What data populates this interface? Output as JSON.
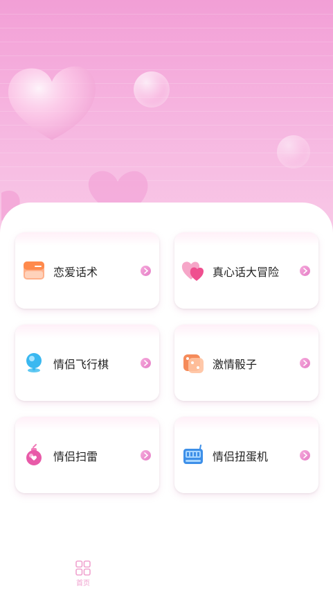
{
  "colors": {
    "accent": "#f29fd6",
    "card_bg": "#ffffff",
    "text": "#222222",
    "tab_active": "#f0a2cf"
  },
  "games": [
    {
      "label": "恋爱话术",
      "icon": "message-card-icon"
    },
    {
      "label": "真心话大冒险",
      "icon": "hearts-icon"
    },
    {
      "label": "情侣飞行棋",
      "icon": "planet-icon"
    },
    {
      "label": "激情骰子",
      "icon": "dice-icon"
    },
    {
      "label": "情侣扫雷",
      "icon": "bomb-icon"
    },
    {
      "label": "情侣扭蛋机",
      "icon": "gacha-machine-icon"
    }
  ],
  "tabbar": {
    "home_label": "首页",
    "home_icon": "grid-icon"
  }
}
